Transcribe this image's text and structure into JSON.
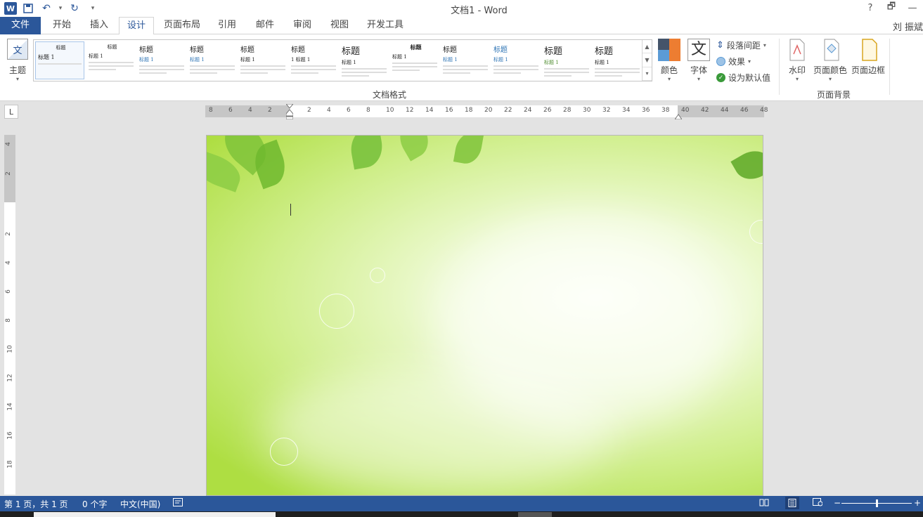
{
  "window": {
    "title": "文档1 - Word",
    "help": "?",
    "restore": "🗗",
    "minimize": "—"
  },
  "qat": {
    "app_icon": "W",
    "save": "💾",
    "undo": "↶",
    "redo": "↻",
    "customize": "▾"
  },
  "tabs": [
    "文件",
    "开始",
    "插入",
    "设计",
    "页面布局",
    "引用",
    "邮件",
    "审阅",
    "视图",
    "开发工具"
  ],
  "active_tab": "设计",
  "user": "刘 振斌",
  "ribbon": {
    "themes_label": "主题",
    "style_gallery": [
      {
        "heading": "标题",
        "sub": "标题 1"
      },
      {
        "heading": "标题",
        "sub": "标题 1"
      },
      {
        "heading": "标题",
        "sub": "标题 1"
      },
      {
        "heading": "标题",
        "sub": "标题 1"
      },
      {
        "heading": "标题",
        "sub": "标题 1"
      },
      {
        "heading": "标题",
        "sub": "1 标题 1"
      },
      {
        "heading": "标题",
        "sub": "标题 1"
      },
      {
        "heading": "标题",
        "sub": "标题 1"
      },
      {
        "heading": "标题",
        "sub": "标题 1"
      },
      {
        "heading": "标题",
        "sub": "标题 1"
      },
      {
        "heading": "标题",
        "sub": "标题 1"
      },
      {
        "heading": "标题",
        "sub": "标题 1"
      }
    ],
    "document_format_label": "文档格式",
    "colors_label": "颜色",
    "fonts_label": "字体",
    "fonts_glyph": "文",
    "paragraph_spacing_label": "段落间距",
    "effects_label": "效果",
    "set_default_label": "设为默认值",
    "watermark_label": "水印",
    "page_color_label": "页面颜色",
    "page_borders_label": "页面边框",
    "page_background_label": "页面背景"
  },
  "ruler": {
    "tab_selector": "L",
    "h_numbers": [
      "8",
      "6",
      "4",
      "2",
      "2",
      "4",
      "6",
      "8",
      "10",
      "12",
      "14",
      "16",
      "18",
      "20",
      "22",
      "24",
      "26",
      "28",
      "30",
      "32",
      "34",
      "36",
      "38",
      "40",
      "42",
      "44",
      "46",
      "48"
    ],
    "v_numbers": [
      "4",
      "2",
      "2",
      "4",
      "6",
      "8",
      "10",
      "12",
      "14",
      "16",
      "18"
    ]
  },
  "status": {
    "page": "第 1 页，共 1 页",
    "words": "0 个字",
    "language": "中文(中国)",
    "zoom_minus": "−",
    "zoom_plus": "+"
  },
  "colors": {
    "accent": "#2b579a",
    "page_green": "#aede42"
  }
}
